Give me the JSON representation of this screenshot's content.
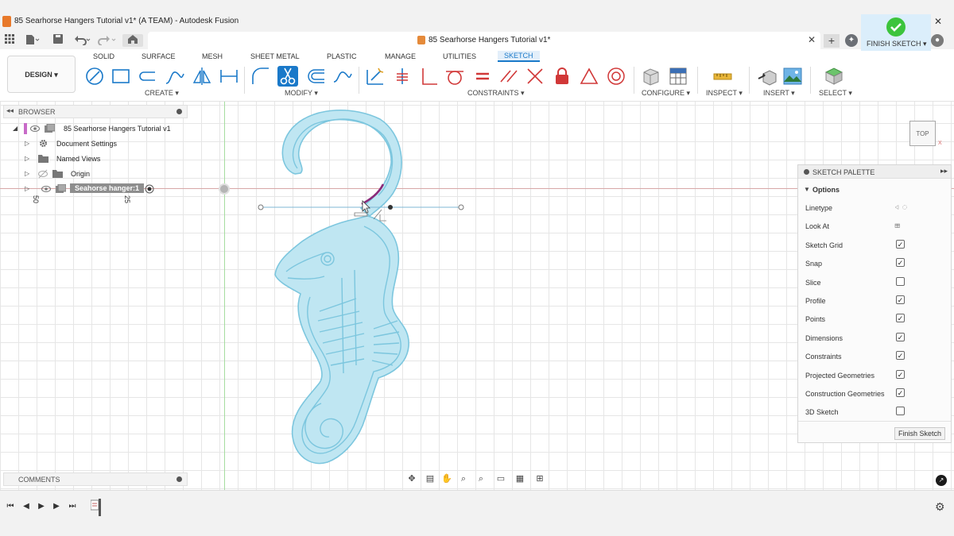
{
  "window": {
    "title": "85 Searhorse Hangers Tutorial v1* (A TEAM) - Autodesk Fusion",
    "controls": {
      "minimize": "—",
      "maximize": "❐",
      "close": "✕"
    }
  },
  "document_tab": {
    "title": "85 Searhorse Hangers Tutorial v1*",
    "close": "✕",
    "new_tab": "+"
  },
  "ribbon": {
    "workspace": "DESIGN ▾",
    "tabs": [
      "SOLID",
      "SURFACE",
      "MESH",
      "SHEET METAL",
      "PLASTIC",
      "MANAGE",
      "UTILITIES",
      "SKETCH"
    ],
    "active_tab": "SKETCH",
    "groups": {
      "create": "CREATE ▾",
      "modify": "MODIFY ▾",
      "constraints": "CONSTRAINTS ▾",
      "configure": "CONFIGURE ▾",
      "inspect": "INSPECT ▾",
      "insert": "INSERT ▾",
      "select": "SELECT ▾",
      "finish_sketch": "FINISH SKETCH ▾"
    },
    "accent_color": "#1a79c9"
  },
  "browser": {
    "title": "BROWSER",
    "items": [
      {
        "label": "85 Searhorse Hangers Tutorial v1"
      },
      {
        "label": "Document Settings"
      },
      {
        "label": "Named Views"
      },
      {
        "label": "Origin"
      },
      {
        "label": "Seahorse hanger:1"
      }
    ]
  },
  "rulers": {
    "a": "50",
    "b": "25"
  },
  "viewcube": {
    "face": "TOP"
  },
  "sketch_palette": {
    "title": "SKETCH PALETTE",
    "section": "Options",
    "options": [
      {
        "label": "Linetype",
        "kind": "icon"
      },
      {
        "label": "Look At",
        "kind": "icon"
      },
      {
        "label": "Sketch Grid",
        "checked": true
      },
      {
        "label": "Snap",
        "checked": true
      },
      {
        "label": "Slice",
        "checked": false
      },
      {
        "label": "Profile",
        "checked": true
      },
      {
        "label": "Points",
        "checked": true
      },
      {
        "label": "Dimensions",
        "checked": true
      },
      {
        "label": "Constraints",
        "checked": true
      },
      {
        "label": "Projected Geometries",
        "checked": true
      },
      {
        "label": "Construction Geometries",
        "checked": true
      },
      {
        "label": "3D Sketch",
        "checked": false
      }
    ],
    "finish_button": "Finish Sketch"
  },
  "comments": {
    "title": "COMMENTS"
  },
  "colors": {
    "sketch_profile": "#bfe6f2",
    "sketch_stroke": "#7cc6de",
    "selected_arc": "#8a2a7a"
  }
}
